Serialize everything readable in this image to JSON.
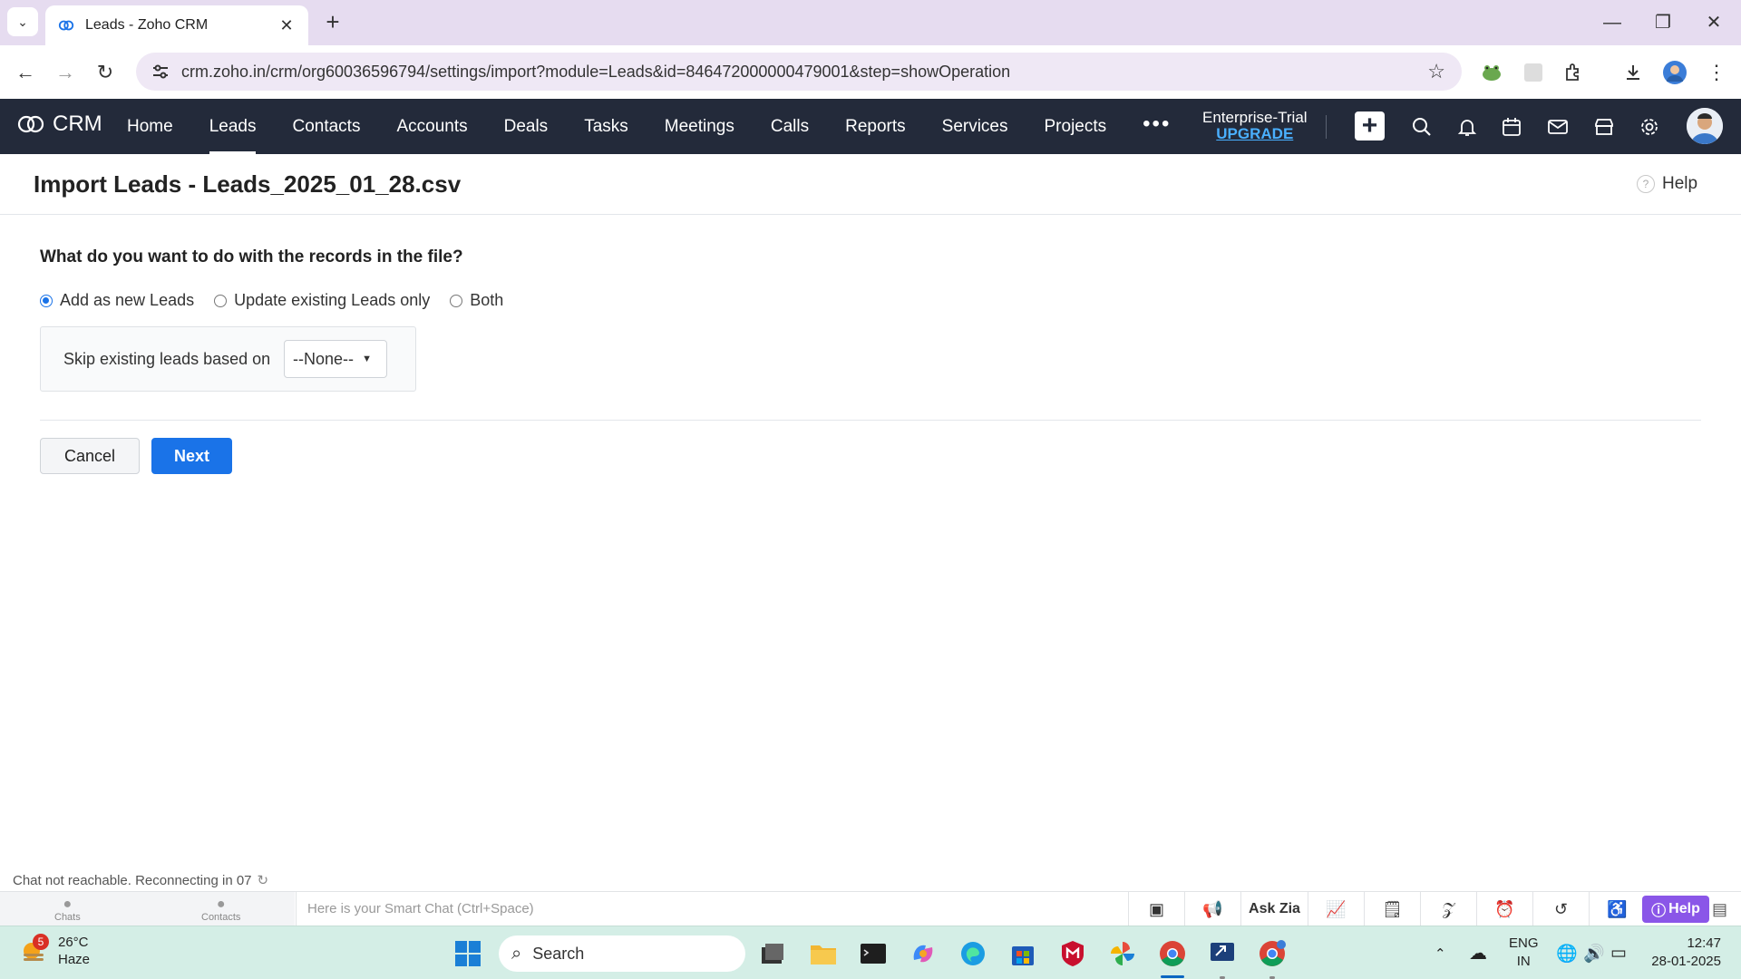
{
  "browser": {
    "tab_title": "Leads - Zoho CRM",
    "url": "crm.zoho.in/crm/org60036596794/settings/import?module=Leads&id=846472000000479001&step=showOperation"
  },
  "crm_nav": {
    "logo": "CRM",
    "items": [
      {
        "label": "Home",
        "active": false
      },
      {
        "label": "Leads",
        "active": true
      },
      {
        "label": "Contacts",
        "active": false
      },
      {
        "label": "Accounts",
        "active": false
      },
      {
        "label": "Deals",
        "active": false
      },
      {
        "label": "Tasks",
        "active": false
      },
      {
        "label": "Meetings",
        "active": false
      },
      {
        "label": "Calls",
        "active": false
      },
      {
        "label": "Reports",
        "active": false
      },
      {
        "label": "Services",
        "active": false
      },
      {
        "label": "Projects",
        "active": false
      }
    ],
    "more": "•••",
    "plan_name": "Enterprise-Trial",
    "upgrade": "UPGRADE"
  },
  "page": {
    "title": "Import Leads - Leads_2025_01_28.csv",
    "help": "Help",
    "question": "What do you want to do with the records in the file?",
    "options": [
      {
        "label": "Add as new Leads",
        "checked": true
      },
      {
        "label": "Update existing Leads only",
        "checked": false
      },
      {
        "label": "Both",
        "checked": false
      }
    ],
    "skip_label": "Skip existing leads based on",
    "skip_value": "--None--",
    "cancel": "Cancel",
    "next": "Next",
    "chat_status": "Chat not reachable. Reconnecting in 07"
  },
  "bottom_bar": {
    "chats": "Chats",
    "contacts": "Contacts",
    "smart_chat_placeholder": "Here is your Smart Chat (Ctrl+Space)",
    "ask_zia": "Ask Zia",
    "help": "Help"
  },
  "taskbar": {
    "weather_badge": "5",
    "temperature": "26°C",
    "condition": "Haze",
    "search": "Search",
    "lang_top": "ENG",
    "lang_bottom": "IN",
    "time": "12:47",
    "date": "28-01-2025"
  },
  "colors": {
    "nav_bg": "#232a3a",
    "primary_blue": "#1a73e8",
    "upgrade_link": "#4ab0ff",
    "help_purple": "#8a56e8",
    "tabbar_bg": "#e6dcf0",
    "taskbar_bg": "#d4eee6"
  }
}
